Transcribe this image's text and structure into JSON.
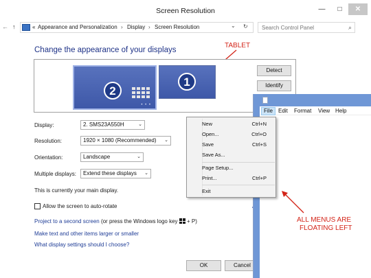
{
  "window": {
    "title": "Screen Resolution",
    "minimize": "—",
    "maximize": "□",
    "close": "✕"
  },
  "address": {
    "crumb_prefix": "«",
    "crumbs": [
      "Appearance and Personalization",
      "Display",
      "Screen Resolution"
    ],
    "separator": "›",
    "dropdown": "⌄",
    "refresh": "↻",
    "search_placeholder": "Search Control Panel",
    "back": "←",
    "forward": "→",
    "up": "↑"
  },
  "heading": "Change the appearance of your displays",
  "annotations": {
    "tablet": "TABLET",
    "menus_line1": "ALL MENUS ARE",
    "menus_line2": "FLOATING LEFT"
  },
  "monitors": [
    {
      "number": "2",
      "selected": true
    },
    {
      "number": "1",
      "selected": false
    }
  ],
  "monitor_dots": "• • •",
  "buttons": {
    "detect": "Detect",
    "identify": "Identify",
    "ok": "OK",
    "cancel": "Cancel"
  },
  "form": {
    "display_label": "Display:",
    "display_value": "2. SMS23A550H",
    "resolution_label": "Resolution:",
    "resolution_value": "1920 × 1080 (Recommended)",
    "orientation_label": "Orientation:",
    "orientation_value": "Landscape",
    "multiple_label": "Multiple displays:",
    "multiple_value": "Extend these displays",
    "main_display_text": "This is currently your main display.",
    "autorotate_label": "Allow the screen to auto-rotate",
    "autorotate_checked": false,
    "advanced_fragment": "Ad"
  },
  "links": {
    "project": "Project to a second screen",
    "project_suffix_a": " (or press the Windows logo key ",
    "project_suffix_b": " + P)",
    "text_size": "Make text and other items larger or smaller",
    "which_settings": "What display settings should I choose?"
  },
  "notepad": {
    "menus": [
      "File",
      "Edit",
      "Format",
      "View",
      "Help"
    ],
    "active_menu": "File"
  },
  "file_menu": [
    {
      "label": "New",
      "shortcut": "Ctrl+N"
    },
    {
      "label": "Open...",
      "shortcut": "Ctrl+O"
    },
    {
      "label": "Save",
      "shortcut": "Ctrl+S"
    },
    {
      "label": "Save As...",
      "shortcut": ""
    },
    {
      "label": "Page Setup...",
      "shortcut": ""
    },
    {
      "label": "Print...",
      "shortcut": "Ctrl+P"
    },
    {
      "label": "Exit",
      "shortcut": ""
    }
  ],
  "colors": {
    "heading": "#1e3287",
    "link": "#1e3c96",
    "annotation": "#d32418",
    "monitor": "#4a64b3",
    "notepad_frame": "#6f97d6"
  }
}
